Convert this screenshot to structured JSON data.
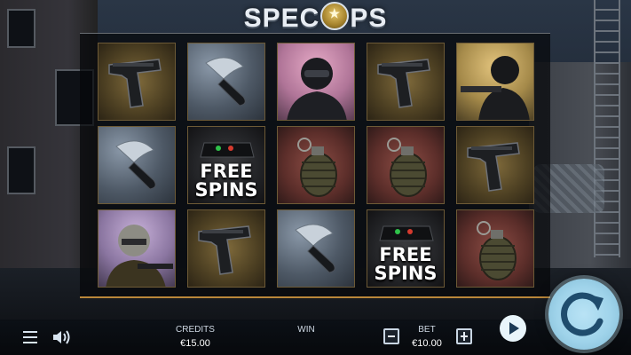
{
  "logo": {
    "text_left": "SPEC",
    "text_right": "PS",
    "emblem_icon": "star-emblem-icon"
  },
  "reels": [
    [
      "pistol",
      "knife",
      "soldier-masked",
      "pistol",
      "soldier-rifle"
    ],
    [
      "knife",
      "free-spins",
      "grenade",
      "grenade",
      "pistol"
    ],
    [
      "soldier-helmet",
      "pistol",
      "knife",
      "free-spins",
      "grenade"
    ]
  ],
  "free_spins": {
    "line1": "FREE",
    "line2": "SPINS"
  },
  "bottom_bar": {
    "credits_label": "CREDITS",
    "credits_value": "€15.00",
    "win_label": "WIN",
    "bet_label": "BET",
    "bet_value": "€10.00"
  },
  "colors": {
    "accent": "#9fd3ea",
    "frame_gold": "#b9863a"
  }
}
